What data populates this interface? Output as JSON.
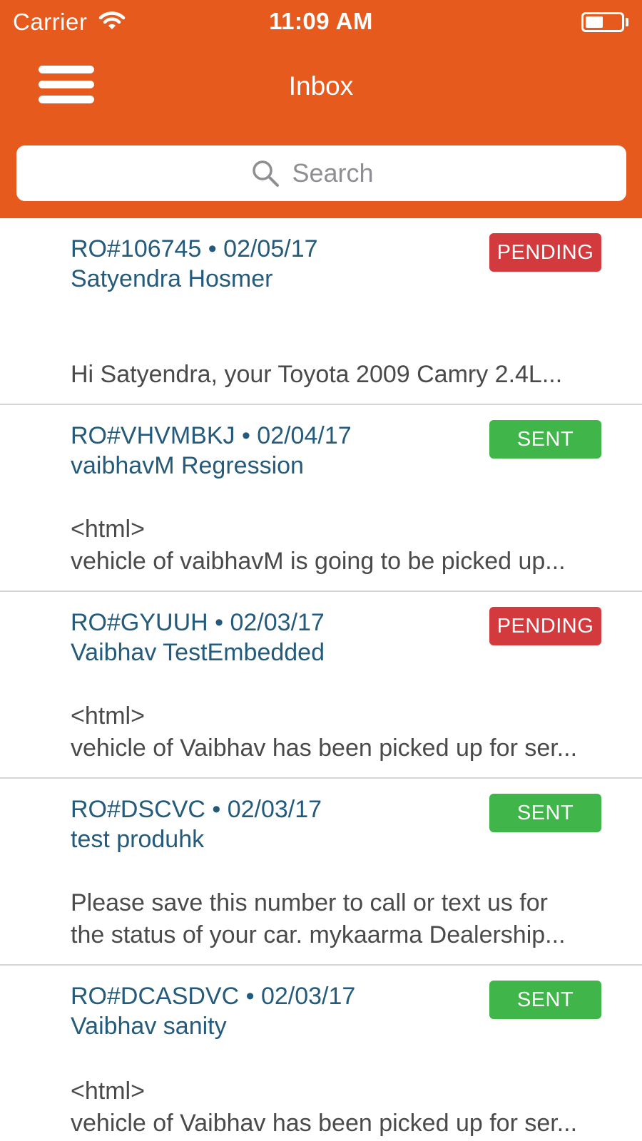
{
  "status_bar": {
    "carrier": "Carrier",
    "time": "11:09 AM",
    "battery_level": 0.5
  },
  "nav": {
    "title": "Inbox",
    "menu_icon": "hamburger-menu-icon"
  },
  "search": {
    "placeholder": "Search",
    "icon": "search-icon"
  },
  "colors": {
    "header": "#e65a1e",
    "link_text": "#245b7c",
    "pending": "#d33a3e",
    "sent": "#3fb54a"
  },
  "messages": [
    {
      "ro": "RO#106745",
      "date": "02/05/17",
      "head": "RO#106745 • 02/05/17",
      "name": "Satyendra Hosmer",
      "status": "PENDING",
      "status_color": "#d33a3e",
      "preview": [
        "Hi Satyendra, your Toyota 2009 Camry 2.4L..."
      ]
    },
    {
      "ro": "RO#VHVMBKJ",
      "date": "02/04/17",
      "head": "RO#VHVMBKJ • 02/04/17",
      "name": "vaibhavM Regression",
      "status": "SENT",
      "status_color": "#3fb54a",
      "preview": [
        "<html>",
        "vehicle of vaibhavM is going to be picked up..."
      ]
    },
    {
      "ro": "RO#GYUUH",
      "date": "02/03/17",
      "head": "RO#GYUUH • 02/03/17",
      "name": "Vaibhav TestEmbedded",
      "status": "PENDING",
      "status_color": "#d33a3e",
      "preview": [
        "<html>",
        "vehicle of Vaibhav has been picked up for ser..."
      ]
    },
    {
      "ro": "RO#DSCVC",
      "date": "02/03/17",
      "head": "RO#DSCVC • 02/03/17",
      "name": "test produhk",
      "status": "SENT",
      "status_color": "#3fb54a",
      "preview": [
        "Please save this number to call or text us for",
        "the status of your car. mykaarma Dealership..."
      ]
    },
    {
      "ro": "RO#DCASDVC",
      "date": "02/03/17",
      "head": "RO#DCASDVC • 02/03/17",
      "name": "Vaibhav sanity",
      "status": "SENT",
      "status_color": "#3fb54a",
      "preview": [
        "<html>",
        "vehicle of Vaibhav has been picked up for ser..."
      ]
    }
  ]
}
